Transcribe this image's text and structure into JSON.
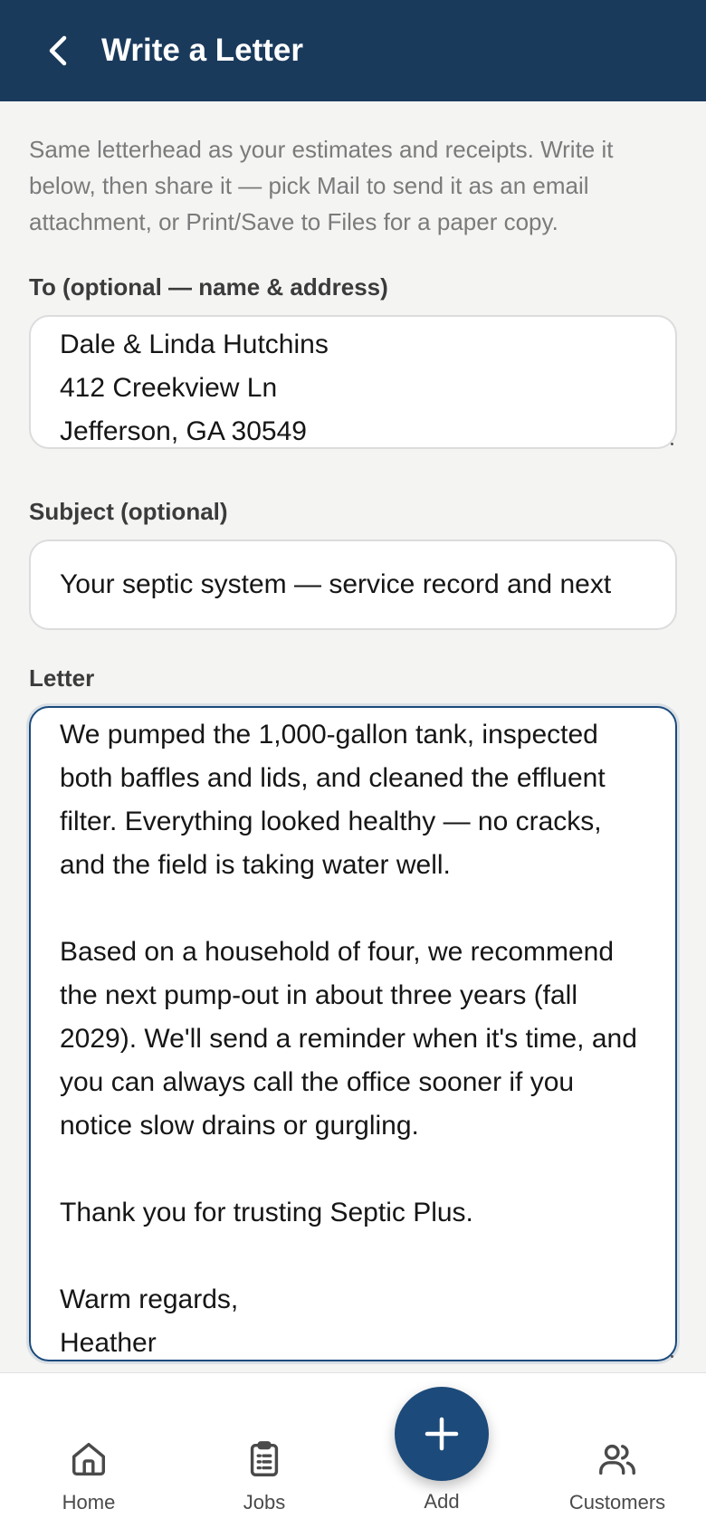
{
  "header": {
    "title": "Write a Letter",
    "back_icon": "chevron-left-icon"
  },
  "intro": "Same letterhead as your estimates and receipts. Write it below, then share it — pick Mail to send it as an email attachment, or Print/Save to Files for a paper copy.",
  "to": {
    "label": "To (optional — name & address)",
    "value": "Dale & Linda Hutchins\n412 Creekview Ln\nJefferson, GA 30549"
  },
  "subject": {
    "label": "Subject (optional)",
    "value": "Your septic system — service record and next"
  },
  "letter": {
    "label": "Letter",
    "value": "We pumped the 1,000-gallon tank, inspected both baffles and lids, and cleaned the effluent filter. Everything looked healthy — no cracks, and the field is taking water well.\n\nBased on a household of four, we recommend the next pump-out in about three years (fall 2029). We'll send a reminder when it's time, and you can always call the office sooner if you notice slow drains or gurgling.\n\nThank you for trusting Septic Plus.\n\nWarm regards,\nHeather"
  },
  "tabbar": {
    "home": {
      "label": "Home",
      "icon": "home-icon"
    },
    "jobs": {
      "label": "Jobs",
      "icon": "clipboard-list-icon"
    },
    "add": {
      "label": "Add",
      "icon": "plus-icon"
    },
    "customers": {
      "label": "Customers",
      "icon": "users-icon"
    }
  },
  "colors": {
    "header_bg": "#1a3a5c",
    "accent": "#1c4a7a",
    "page_bg": "#f4f4f3"
  }
}
